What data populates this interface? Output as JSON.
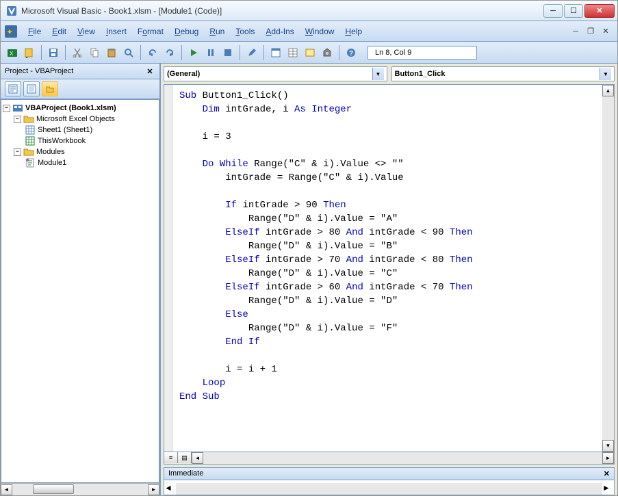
{
  "window": {
    "title": "Microsoft Visual Basic - Book1.xlsm - [Module1 (Code)]"
  },
  "menu": {
    "items": [
      "File",
      "Edit",
      "View",
      "Insert",
      "Format",
      "Debug",
      "Run",
      "Tools",
      "Add-Ins",
      "Window",
      "Help"
    ]
  },
  "toolbar": {
    "status": "Ln 8, Col 9"
  },
  "project": {
    "title": "Project - VBAProject",
    "root": "VBAProject (Book1.xlsm)",
    "folder_excel": "Microsoft Excel Objects",
    "sheet1": "Sheet1 (Sheet1)",
    "thiswb": "ThisWorkbook",
    "folder_modules": "Modules",
    "module1": "Module1"
  },
  "combos": {
    "left": "(General)",
    "right": "Button1_Click"
  },
  "code": {
    "tokens": [
      [
        [
          "kw",
          "Sub"
        ],
        [
          "",
          " Button1_Click()"
        ]
      ],
      [
        [
          "",
          "    "
        ],
        [
          "kw",
          "Dim"
        ],
        [
          "",
          " intGrade, i "
        ],
        [
          "kw",
          "As Integer"
        ]
      ],
      [
        [
          "",
          ""
        ]
      ],
      [
        [
          "",
          "    i = 3"
        ]
      ],
      [
        [
          "",
          ""
        ]
      ],
      [
        [
          "",
          "    "
        ],
        [
          "kw",
          "Do While"
        ],
        [
          "",
          " Range(\"C\" & i).Value <> \"\""
        ]
      ],
      [
        [
          "",
          "        intGrade = Range(\"C\" & i).Value"
        ]
      ],
      [
        [
          "",
          "        "
        ]
      ],
      [
        [
          "",
          "        "
        ],
        [
          "kw",
          "If"
        ],
        [
          "",
          " intGrade > 90 "
        ],
        [
          "kw",
          "Then"
        ]
      ],
      [
        [
          "",
          "            Range(\"D\" & i).Value = \"A\""
        ]
      ],
      [
        [
          "",
          "        "
        ],
        [
          "kw",
          "ElseIf"
        ],
        [
          "",
          " intGrade > 80 "
        ],
        [
          "kw",
          "And"
        ],
        [
          "",
          " intGrade < 90 "
        ],
        [
          "kw",
          "Then"
        ]
      ],
      [
        [
          "",
          "            Range(\"D\" & i).Value = \"B\""
        ]
      ],
      [
        [
          "",
          "        "
        ],
        [
          "kw",
          "ElseIf"
        ],
        [
          "",
          " intGrade > 70 "
        ],
        [
          "kw",
          "And"
        ],
        [
          "",
          " intGrade < 80 "
        ],
        [
          "kw",
          "Then"
        ]
      ],
      [
        [
          "",
          "            Range(\"D\" & i).Value = \"C\""
        ]
      ],
      [
        [
          "",
          "        "
        ],
        [
          "kw",
          "ElseIf"
        ],
        [
          "",
          " intGrade > 60 "
        ],
        [
          "kw",
          "And"
        ],
        [
          "",
          " intGrade < 70 "
        ],
        [
          "kw",
          "Then"
        ]
      ],
      [
        [
          "",
          "            Range(\"D\" & i).Value = \"D\""
        ]
      ],
      [
        [
          "",
          "        "
        ],
        [
          "kw",
          "Else"
        ]
      ],
      [
        [
          "",
          "            Range(\"D\" & i).Value = \"F\""
        ]
      ],
      [
        [
          "",
          "        "
        ],
        [
          "kw",
          "End If"
        ]
      ],
      [
        [
          "",
          ""
        ]
      ],
      [
        [
          "",
          "        i = i + 1"
        ]
      ],
      [
        [
          "",
          "    "
        ],
        [
          "kw",
          "Loop"
        ]
      ],
      [
        [
          "kw",
          "End Sub"
        ]
      ]
    ]
  },
  "immediate": {
    "title": "Immediate"
  }
}
